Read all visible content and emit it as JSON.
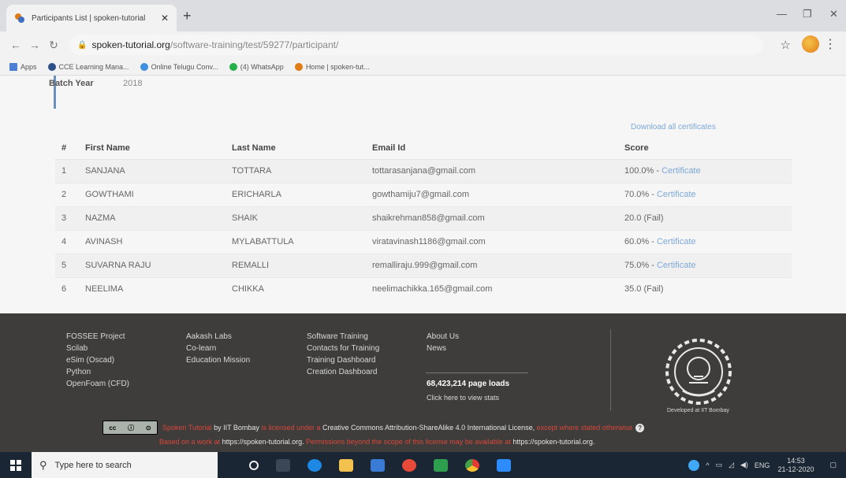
{
  "browser": {
    "tab_title": "Participants List | spoken-tutorial",
    "url_host": "spoken-tutorial.org",
    "url_path": "/software-training/test/59277/participant/",
    "bookmarks": [
      {
        "label": "Apps",
        "color": "#4a7fd3"
      },
      {
        "label": "CCE Learning Mana...",
        "color": "#2e4e8a"
      },
      {
        "label": "Online Telugu Conv...",
        "color": "#3f8fe0"
      },
      {
        "label": "(4) WhatsApp",
        "color": "#25b14a"
      },
      {
        "label": "Home | spoken-tut...",
        "color": "#e07b16"
      }
    ]
  },
  "page": {
    "batch_label": "Batch Year",
    "batch_value": "2018",
    "download_all": "Download all certificates",
    "columns": [
      "#",
      "First Name",
      "Last Name",
      "Email Id",
      "Score"
    ],
    "rows": [
      {
        "n": "1",
        "first": "SANJANA",
        "last": "TOTTARA",
        "email": "tottarasanjana@gmail.com",
        "score": "100.0% -",
        "cert": "Certificate"
      },
      {
        "n": "2",
        "first": "GOWTHAMI",
        "last": "ERICHARLA",
        "email": "gowthamiju7@gmail.com",
        "score": "70.0% -",
        "cert": "Certificate"
      },
      {
        "n": "3",
        "first": "NAZMA",
        "last": "SHAIK",
        "email": "shaikrehman858@gmail.com",
        "score": "20.0 (Fail)",
        "cert": ""
      },
      {
        "n": "4",
        "first": "AVINASH",
        "last": "MYLABATTULA",
        "email": "viratavinash1186@gmail.com",
        "score": "60.0% -",
        "cert": "Certificate"
      },
      {
        "n": "5",
        "first": "SUVARNA RAJU",
        "last": "REMALLI",
        "email": "remalliraju.999@gmail.com",
        "score": "75.0% -",
        "cert": "Certificate"
      },
      {
        "n": "6",
        "first": "NEELIMA",
        "last": "CHIKKA",
        "email": "neelimachikka.165@gmail.com",
        "score": "35.0 (Fail)",
        "cert": ""
      }
    ]
  },
  "footer": {
    "col1": [
      "FOSSEE Project",
      "Scilab",
      "eSim (Oscad)",
      "Python",
      "OpenFoam (CFD)"
    ],
    "col2": [
      "Aakash Labs",
      "Co-learn",
      "Education Mission"
    ],
    "col3": [
      "Software Training",
      "Contacts for Training",
      "Training Dashboard",
      "Creation Dashboard"
    ],
    "col4": [
      "About Us",
      "News"
    ],
    "page_loads": "68,423,214 page loads",
    "stats_link": "Click here to view stats",
    "developed_by": "Developed at IIT Bombay",
    "license_red1": "Spoken Tutorial",
    "license_white1": "by IIT Bombay",
    "license_red2": "is licensed under a",
    "license_white2": "Creative Commons Attribution-ShareAlike 4.0 International License,",
    "license_red3": "except where stated otherwise",
    "based_red": "Based on a work at",
    "based_white": "https://spoken-tutorial.org.",
    "perm_red": "Permissions beyond the scope of this license may be available at",
    "perm_white": "https://spoken-tutorial.org."
  },
  "taskbar": {
    "search_placeholder": "Type here to search",
    "lang": "ENG",
    "time": "14:53",
    "date": "21-12-2020"
  }
}
